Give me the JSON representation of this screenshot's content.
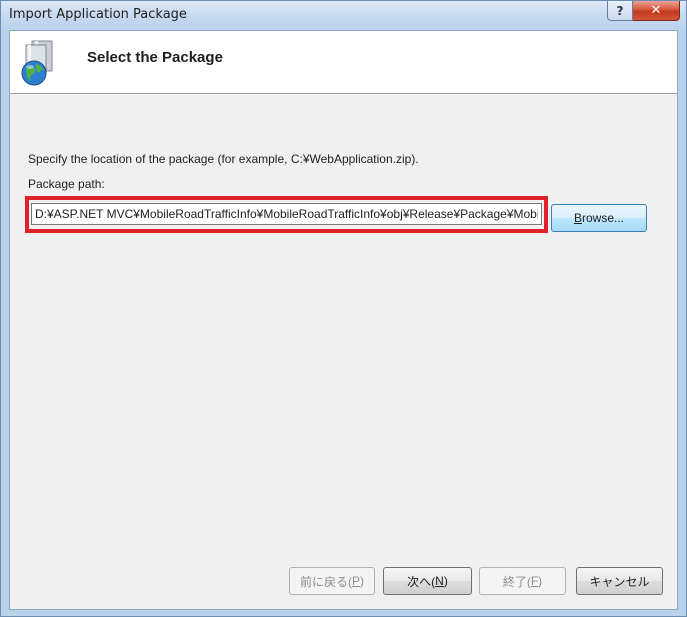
{
  "window": {
    "title": "Import Application Package",
    "help_glyph": "?",
    "close_glyph": "✕"
  },
  "header": {
    "title": "Select the Package",
    "icon": "package-globe-icon"
  },
  "body": {
    "instruction": "Specify the location of the package (for example, C:¥WebApplication.zip).",
    "path_label": "Package path:",
    "path_value": "D:¥ASP.NET MVC¥MobileRoadTrafficInfo¥MobileRoadTrafficInfo¥obj¥Release¥Package¥MobileRoadTrafficInfo.zip",
    "browse_label": "rowse...",
    "browse_accel": "B"
  },
  "footer": {
    "back": {
      "pre": "前に戻る(",
      "accel": "P",
      "post": ")"
    },
    "next": {
      "pre": "次へ(",
      "accel": "N",
      "post": ")"
    },
    "finish": {
      "pre": "終了(",
      "accel": "F",
      "post": ")"
    },
    "cancel": {
      "label": "キャンセル"
    }
  },
  "colors": {
    "highlight": "#e0222a",
    "titlebar": "#c6daf0",
    "close": "#c3381d"
  }
}
